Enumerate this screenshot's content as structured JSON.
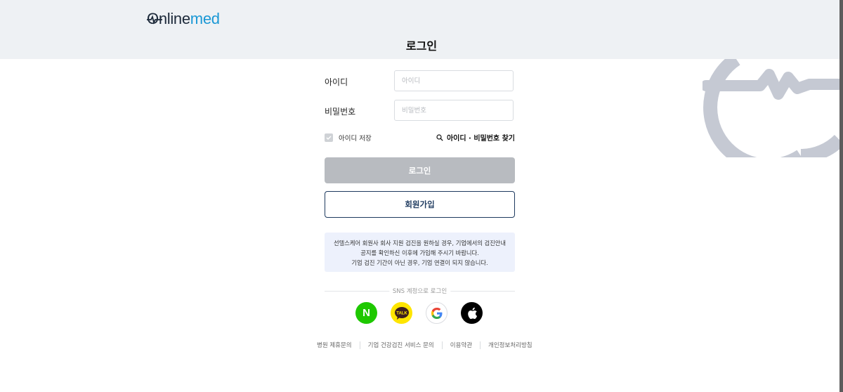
{
  "brand": {
    "logo_prefix": "O",
    "logo_main": "nline",
    "logo_suffix": "med"
  },
  "page": {
    "title": "로그인"
  },
  "form": {
    "id_label": "아이디",
    "id_placeholder": "아이디",
    "id_value": "",
    "password_label": "비밀번호",
    "password_placeholder": "비밀번호",
    "password_value": "",
    "save_id_label": "아이디 저장",
    "save_id_checked": false,
    "find_link": "아이디 · 비밀번호 찾기"
  },
  "buttons": {
    "login": "로그인",
    "signup": "회원가입"
  },
  "notice": {
    "lines": [
      "선텔스케어 회원사 회사 지원 검진을 원하실 경우, 기업에서의 검진안내",
      "공지를 확인하신 이후에 가입해 주시기 바랍니다.",
      "기업 검진 기간이 아닌 경우, 기업 연결이 되지 않습니다."
    ]
  },
  "sns": {
    "divider": "SNS 계정으로 로그인",
    "providers": [
      {
        "name": "naver",
        "glyph": "N",
        "color": "#1ec800"
      },
      {
        "name": "kakao",
        "glyph": "TALK",
        "color": "#fee500"
      },
      {
        "name": "google",
        "glyph": "G",
        "color": "#ffffff"
      },
      {
        "name": "apple",
        "glyph": "apple-icon",
        "color": "#000000"
      }
    ]
  },
  "footer": {
    "links": [
      "병원 제휴문의",
      "기업 건강검진 서비스 문의",
      "이용약관",
      "개인정보처리방침"
    ]
  },
  "colors": {
    "header_bg": "#eef1f4",
    "brand_blue": "#1a98d5",
    "brand_dark": "#1d2a3a",
    "login_disabled": "#b8bbc0",
    "signup_border": "#1e3a5f",
    "notice_bg": "#edf1fc",
    "decor_gray": "#c5c9d3"
  }
}
